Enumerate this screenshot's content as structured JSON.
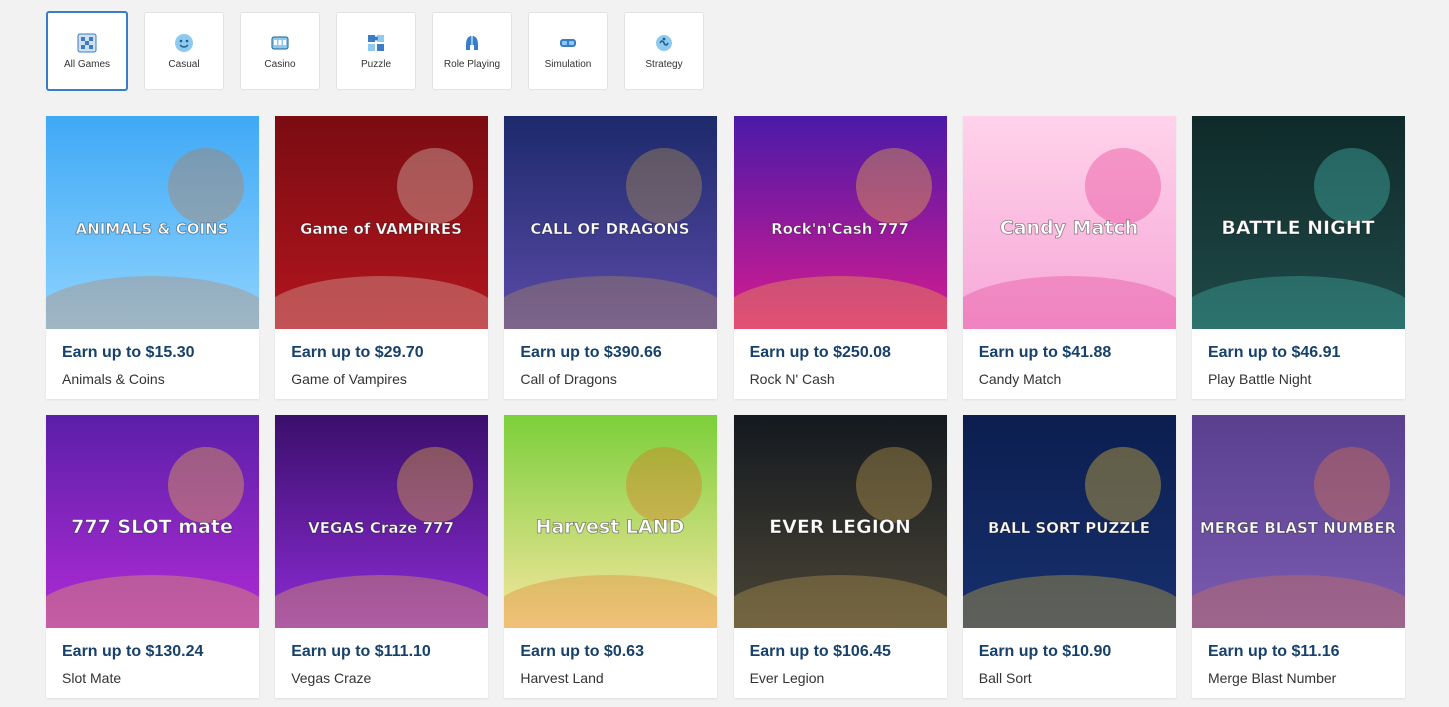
{
  "filters": [
    {
      "label": "All Games",
      "icon": "checkered-grid-icon",
      "active": true
    },
    {
      "label": "Casual",
      "icon": "smiley-icon",
      "active": false
    },
    {
      "label": "Casino",
      "icon": "slot-machine-icon",
      "active": false
    },
    {
      "label": "Puzzle",
      "icon": "puzzle-icon",
      "active": false
    },
    {
      "label": "Role Playing",
      "icon": "helmet-icon",
      "active": false
    },
    {
      "label": "Simulation",
      "icon": "vr-headset-icon",
      "active": false
    },
    {
      "label": "Strategy",
      "icon": "brain-icon",
      "active": false
    }
  ],
  "games": [
    {
      "earn": "Earn up to $15.30",
      "name": "Animals & Coins",
      "logo_text": "ANIMALS & COINS",
      "colors": [
        "#3fa9f5",
        "#8fd3ff",
        "#c8743a"
      ]
    },
    {
      "earn": "Earn up to $29.70",
      "name": "Game of Vampires",
      "logo_text": "Game of VAMPIRES",
      "colors": [
        "#7a0c12",
        "#b3151d",
        "#e9e0d4"
      ]
    },
    {
      "earn": "Earn up to $390.66",
      "name": "Call of Dragons",
      "logo_text": "CALL OF DRAGONS",
      "colors": [
        "#1c2a6b",
        "#5b4aa8",
        "#c9a24a"
      ]
    },
    {
      "earn": "Earn up to $250.08",
      "name": "Rock N' Cash",
      "logo_text": "Rock'n'Cash 777",
      "colors": [
        "#4a1aa8",
        "#d81b8f",
        "#ffcc33"
      ]
    },
    {
      "earn": "Earn up to $41.88",
      "name": "Candy Match",
      "logo_text": "Candy Match",
      "colors": [
        "#ffd2ea",
        "#f6a8d8",
        "#e2308a"
      ]
    },
    {
      "earn": "Earn up to $46.91",
      "name": "Play Battle Night",
      "logo_text": "BATTLE NIGHT",
      "colors": [
        "#0f2a2a",
        "#1f4a48",
        "#4fd1c5"
      ]
    },
    {
      "earn": "Earn up to $130.24",
      "name": "Slot Mate",
      "logo_text": "777 SLOT mate",
      "colors": [
        "#5b1fa8",
        "#b02bd6",
        "#ffcc33"
      ]
    },
    {
      "earn": "Earn up to $111.10",
      "name": "Vegas Craze",
      "logo_text": "VEGAS Craze 777",
      "colors": [
        "#3a0f6b",
        "#8d2bd6",
        "#ffcc33"
      ]
    },
    {
      "earn": "Earn up to $0.63",
      "name": "Harvest Land",
      "logo_text": "Harvest LAND",
      "colors": [
        "#7ccf3a",
        "#f7e6a0",
        "#e06a1b"
      ]
    },
    {
      "earn": "Earn up to $106.45",
      "name": "Ever Legion",
      "logo_text": "EVER LEGION",
      "colors": [
        "#14191f",
        "#4a4536",
        "#d8b35a"
      ]
    },
    {
      "earn": "Earn up to $10.90",
      "name": "Ball Sort",
      "logo_text": "BALL SORT PUZZLE",
      "colors": [
        "#0c1e4f",
        "#17306e",
        "#ffd233"
      ]
    },
    {
      "earn": "Earn up to $11.16",
      "name": "Merge Blast Number",
      "logo_text": "MERGE BLAST NUMBER",
      "colors": [
        "#5a3f8f",
        "#7a5bb0",
        "#f27d3b"
      ]
    }
  ]
}
